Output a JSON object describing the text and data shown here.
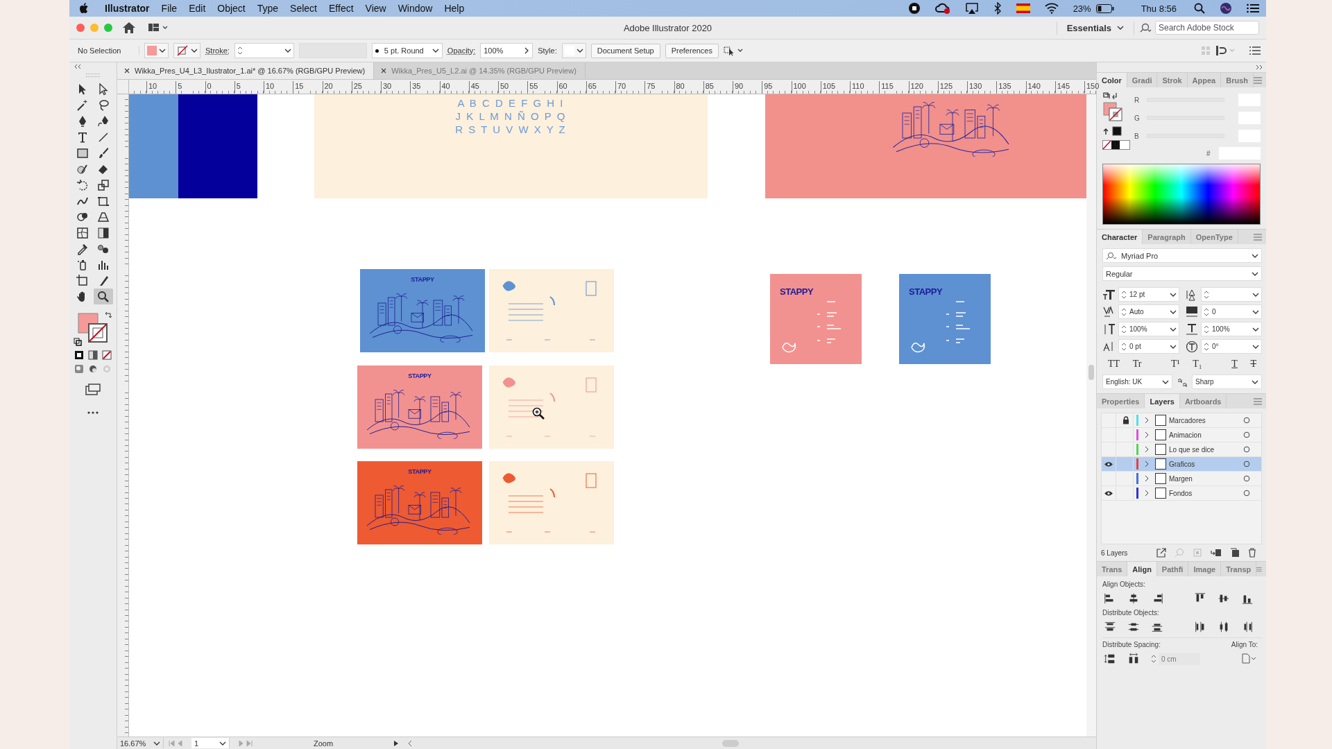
{
  "menu_bar": {
    "app": "Illustrator",
    "items": [
      "File",
      "Edit",
      "Object",
      "Type",
      "Select",
      "Effect",
      "View",
      "Window",
      "Help"
    ],
    "battery": "23%",
    "clock": "Thu 8:56"
  },
  "window": {
    "title": "Adobe Illustrator 2020",
    "workspace": "Essentials",
    "search": {
      "placeholder": "Search Adobe Stock"
    }
  },
  "control_bar": {
    "selection": "No Selection",
    "stroke_label": "Stroke:",
    "brush": "5 pt. Round",
    "opacity_label": "Opacity:",
    "opacity": "100%",
    "style_label": "Style:",
    "buttons": [
      "Document Setup",
      "Preferences"
    ]
  },
  "tabs": [
    {
      "label": "Wikka_Pres_U4_L3_Ilustrator_1.ai* @ 16.67% (RGB/GPU Preview)",
      "selected": true
    },
    {
      "label": "Wikka_Pres_U5_L2.ai @ 14.35% (RGB/GPU Preview)",
      "selected": false
    }
  ],
  "tools": [
    {
      "selected": false
    },
    {
      "selected": false
    },
    {
      "selected": false
    },
    {
      "selected": false
    },
    {
      "selected": false
    },
    {
      "selected": false
    },
    {
      "selected": false
    },
    {
      "selected": false
    },
    {
      "selected": false
    },
    {
      "selected": false
    },
    {
      "selected": false
    },
    {
      "selected": false
    },
    {
      "selected": false
    },
    {
      "selected": false
    },
    {
      "selected": false
    },
    {
      "selected": false
    },
    {
      "selected": false
    },
    {
      "selected": false
    },
    {
      "selected": false
    },
    {
      "selected": false
    },
    {
      "selected": false
    },
    {
      "selected": false
    },
    {
      "selected": false
    },
    {
      "selected": false
    },
    {
      "selected": false
    },
    {
      "selected": false
    },
    {
      "selected": false
    },
    {
      "selected": true
    }
  ],
  "ruler": {
    "marks": [
      "10",
      "5",
      "0",
      "5",
      "10",
      "15",
      "20",
      "25",
      "30",
      "35",
      "40",
      "45",
      "50",
      "55",
      "60",
      "65",
      "70",
      "75",
      "80",
      "85",
      "90",
      "95",
      "100",
      "105",
      "110",
      "115",
      "120",
      "125",
      "130",
      "135",
      "140",
      "145",
      "150"
    ]
  },
  "canvas": {
    "color_blocks": [
      {
        "color": "#5d91d2"
      },
      {
        "color": "#03009b"
      }
    ],
    "alphabet": [
      "A B C D E F G H I",
      "J K L M N Ñ O P Q",
      "R S T U V W X Y Z"
    ],
    "postcards": [
      {
        "color": "#5d91d2",
        "brand": "STAPPY"
      },
      {
        "color": "#f29290",
        "brand": "STAPPY"
      },
      {
        "color": "#ee5a32",
        "brand": "STAPPY"
      }
    ],
    "business_cards": [
      {
        "color": "#f29290",
        "brand": "STAPPY"
      },
      {
        "color": "#5d91d2",
        "brand": "STAPPY"
      }
    ]
  },
  "status_bar": {
    "zoom": "16.67%",
    "artboard": "1",
    "tool": "Zoom"
  },
  "color_panel": {
    "tabs": [
      {
        "label": "Color",
        "selected": true
      },
      {
        "label": "Gradi",
        "selected": false
      },
      {
        "label": "Strok",
        "selected": false
      },
      {
        "label": "Appea",
        "selected": false
      },
      {
        "label": "Brush",
        "selected": false
      }
    ],
    "channels": [
      "R",
      "G",
      "B"
    ],
    "hex_label": "#"
  },
  "character_panel": {
    "tabs": [
      {
        "label": "Character",
        "selected": true
      },
      {
        "label": "Paragraph",
        "selected": false
      },
      {
        "label": "OpenType",
        "selected": false
      }
    ],
    "font": "Myriad Pro",
    "style": "Regular",
    "fields": [
      {
        "kind": "size",
        "value": "12 pt"
      },
      {
        "kind": "leading"
      },
      {
        "kind": "kerning",
        "value": "Auto"
      },
      {
        "kind": "tracking",
        "value": "0"
      },
      {
        "kind": "vscale",
        "value": "100%"
      },
      {
        "kind": "hscale",
        "value": "100%"
      },
      {
        "kind": "baseline",
        "value": "0 pt"
      },
      {
        "kind": "rotation",
        "value": "0°"
      }
    ],
    "type_buttons": [
      {
        "label": "TT",
        "kind": "plain"
      },
      {
        "label": "Tr",
        "kind": "plain"
      },
      {
        "label": "T¹",
        "kind": "plain"
      },
      {
        "label": "T₁",
        "kind": "plain"
      },
      {
        "label": "T",
        "kind": "underline"
      },
      {
        "label": "T",
        "kind": "strike"
      }
    ],
    "language": "English: UK",
    "antialias": "Sharp"
  },
  "layers_panel": {
    "tabs": [
      {
        "label": "Properties",
        "selected": false
      },
      {
        "label": "Layers",
        "selected": true
      },
      {
        "label": "Artboards",
        "selected": false
      }
    ],
    "layers": [
      {
        "name": "Marcadores",
        "color": "#4fe0e6",
        "visible": false,
        "locked": true,
        "selected": false
      },
      {
        "name": "Animacion",
        "color": "#e04fe0",
        "visible": false,
        "locked": false,
        "selected": false
      },
      {
        "name": "Lo que se dice",
        "color": "#56d456",
        "visible": false,
        "locked": false,
        "selected": false
      },
      {
        "name": "Graficos",
        "color": "#e04444",
        "visible": true,
        "locked": false,
        "selected": true
      },
      {
        "name": "Margen",
        "color": "#3f6fe3",
        "visible": false,
        "locked": false,
        "selected": false
      },
      {
        "name": "Fondos",
        "color": "#3030d8",
        "visible": true,
        "locked": false,
        "selected": false
      }
    ],
    "count": "6 Layers"
  },
  "align_panel": {
    "tabs": [
      {
        "label": "Trans",
        "selected": false
      },
      {
        "label": "Align",
        "selected": true
      },
      {
        "label": "Pathfi",
        "selected": false
      },
      {
        "label": "Image",
        "selected": false
      },
      {
        "label": "Transp",
        "selected": false
      }
    ],
    "align_objects": "Align Objects:",
    "distribute_objects": "Distribute Objects:",
    "distribute_spacing": "Distribute Spacing:",
    "spacing_placeholder": "0 cm",
    "align_to": "Align To:"
  }
}
